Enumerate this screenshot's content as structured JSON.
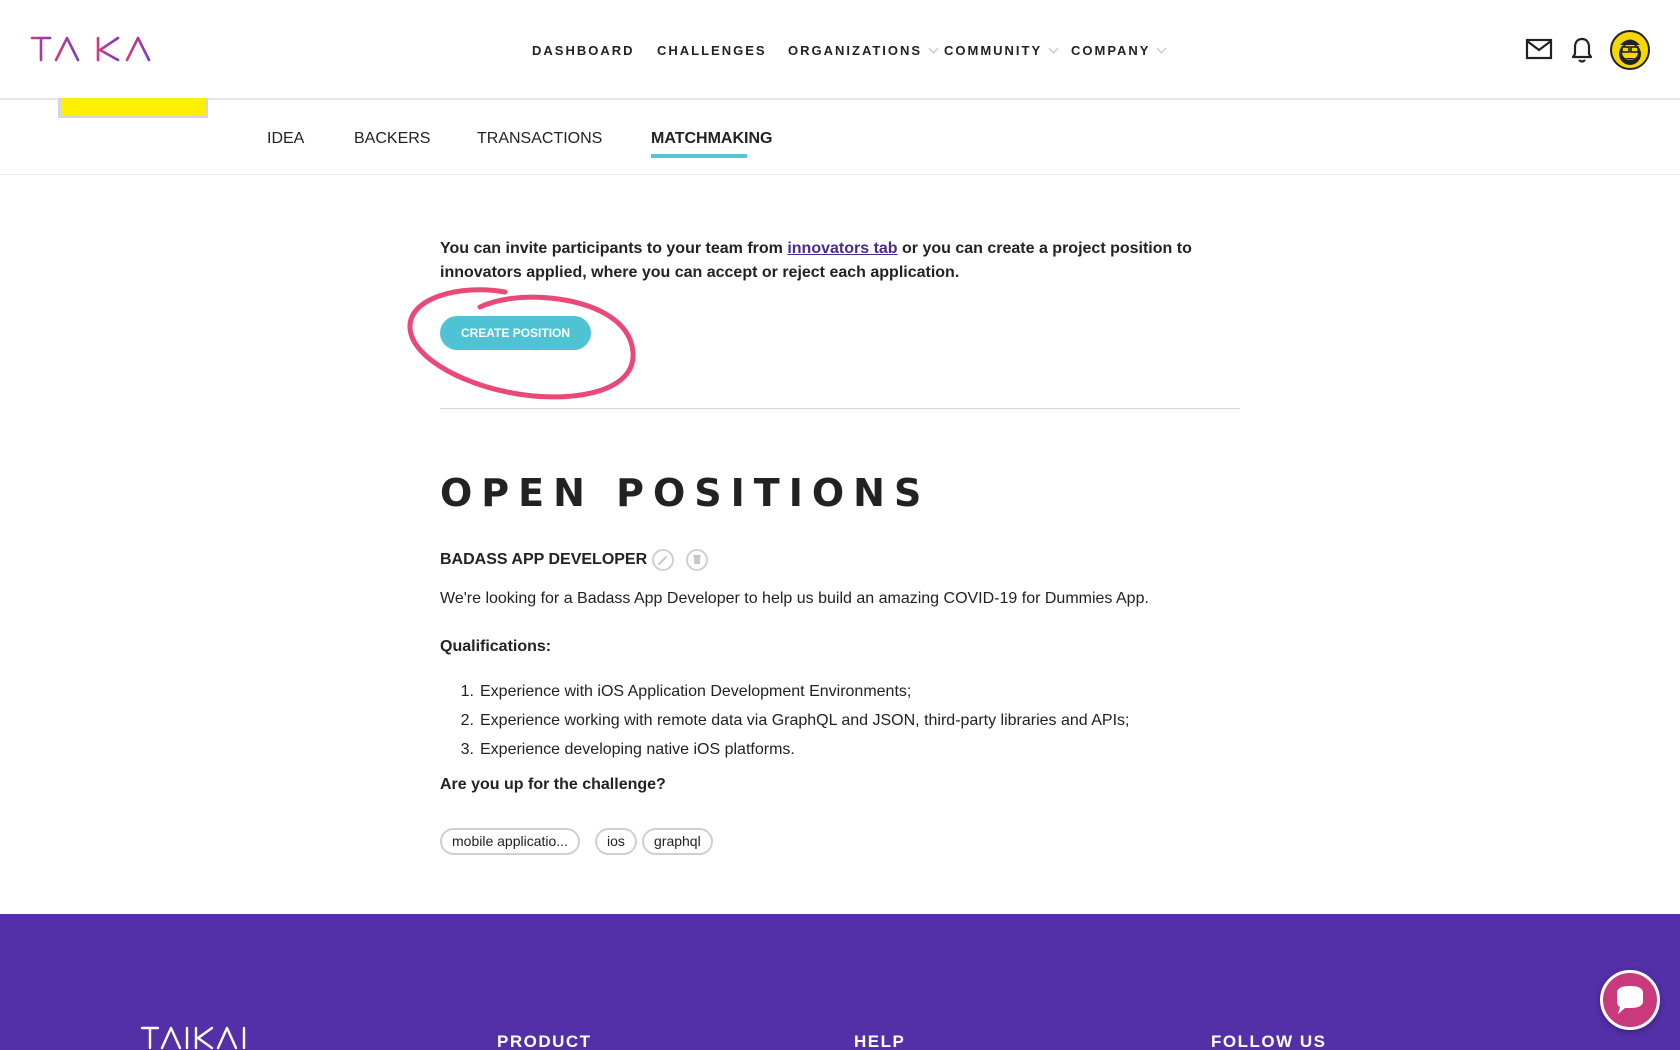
{
  "header": {
    "logo_text": "TAIKAI",
    "nav": [
      {
        "label": "DASHBOARD"
      },
      {
        "label": "CHALLENGES"
      },
      {
        "label": "ORGANIZATIONS"
      },
      {
        "label": "COMMUNITY"
      },
      {
        "label": "COMPANY"
      }
    ],
    "icons": [
      "mail-icon",
      "bell-icon",
      "avatar"
    ]
  },
  "subtabs": [
    {
      "label": "IDEA"
    },
    {
      "label": "BACKERS"
    },
    {
      "label": "TRANSACTIONS"
    },
    {
      "label": "MATCHMAKING",
      "active": true
    }
  ],
  "main": {
    "intro_before": "You can invite participants to your team from ",
    "intro_link": "innovators tab",
    "intro_after": " or you can create a project position to innovators applied, where you can accept or reject each application.",
    "create_button": "CREATE POSITION",
    "section_title": "OPEN POSITIONS",
    "position": {
      "title": "BADASS APP DEVELOPER",
      "description": "We're looking for a Badass App Developer to help us build an amazing COVID-19 for Dummies App.",
      "qualifications_title": "Qualifications:",
      "qualifications": [
        {
          "num": "1.",
          "text": "Experience with iOS Application Development Environments;"
        },
        {
          "num": "2.",
          "text": "Experience working with remote data via GraphQL and JSON, third-party libraries and APIs;"
        },
        {
          "num": "3.",
          "text": "Experience developing native iOS platforms."
        }
      ],
      "closing": "Are you up for the challenge?",
      "tags": [
        "mobile applicatio...",
        "ios",
        "graphql"
      ]
    }
  },
  "footer": {
    "logo_text": "TAIKAI",
    "columns": [
      "PRODUCT",
      "HELP",
      "FOLLOW US"
    ]
  },
  "colors": {
    "accent": "#4fc3d3",
    "footer": "#532fa8",
    "annotation": "#e8386a",
    "link": "#4b2a8f"
  }
}
